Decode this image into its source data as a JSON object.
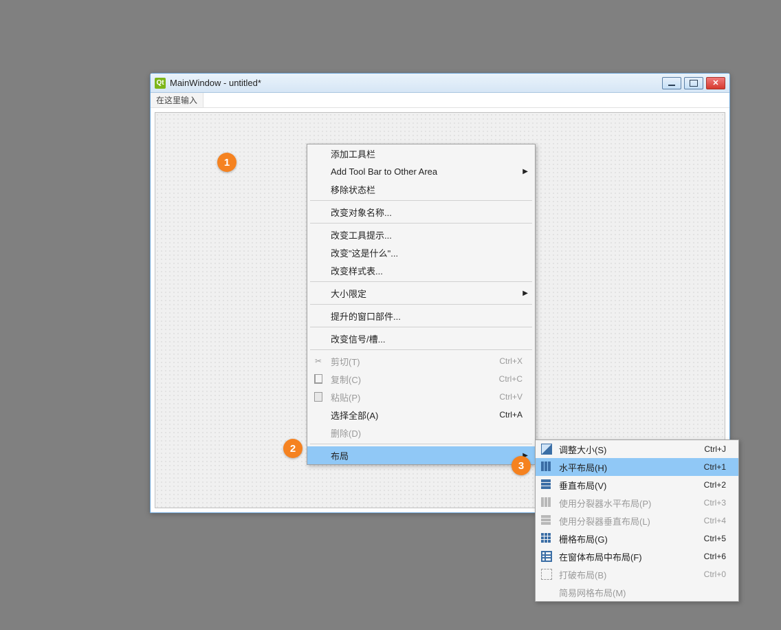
{
  "window": {
    "title": "MainWindow - untitled*"
  },
  "menubar": {
    "placeholder": "在这里输入"
  },
  "callouts": {
    "c1": "1",
    "c2": "2",
    "c3": "3"
  },
  "context_menu": {
    "items": [
      {
        "label": "添加工具栏",
        "submenu": false
      },
      {
        "label": "Add Tool Bar to Other Area",
        "submenu": true
      },
      {
        "label": "移除状态栏",
        "submenu": false
      }
    ],
    "group2": [
      {
        "label": "改变对象名称..."
      }
    ],
    "group3": [
      {
        "label": "改变工具提示..."
      },
      {
        "label": "改变\"这是什么\"..."
      },
      {
        "label": "改变样式表..."
      }
    ],
    "group4": [
      {
        "label": "大小限定",
        "submenu": true
      }
    ],
    "group5": [
      {
        "label": "提升的窗口部件..."
      }
    ],
    "group6": [
      {
        "label": "改变信号/槽..."
      }
    ],
    "edit_group": [
      {
        "label": "剪切(T)",
        "shortcut": "Ctrl+X",
        "icon": "scissors",
        "disabled": true
      },
      {
        "label": "复制(C)",
        "shortcut": "Ctrl+C",
        "icon": "copy",
        "disabled": true
      },
      {
        "label": "粘贴(P)",
        "shortcut": "Ctrl+V",
        "icon": "paste",
        "disabled": true
      },
      {
        "label": "选择全部(A)",
        "shortcut": "Ctrl+A",
        "disabled": false
      },
      {
        "label": "删除(D)",
        "disabled": true
      }
    ],
    "layout_item": {
      "label": "布局",
      "submenu": true
    }
  },
  "submenu": {
    "items": [
      {
        "label": "调整大小(S)",
        "shortcut": "Ctrl+J",
        "icon": "resize",
        "disabled": false
      },
      {
        "label": "水平布局(H)",
        "shortcut": "Ctrl+1",
        "icon": "hbox",
        "disabled": false,
        "highlight": true
      },
      {
        "label": "垂直布局(V)",
        "shortcut": "Ctrl+2",
        "icon": "vbox",
        "disabled": false
      },
      {
        "label": "使用分裂器水平布局(P)",
        "shortcut": "Ctrl+3",
        "icon": "hsplit",
        "disabled": true
      },
      {
        "label": "使用分裂器垂直布局(L)",
        "shortcut": "Ctrl+4",
        "icon": "vsplit",
        "disabled": true
      },
      {
        "label": "栅格布局(G)",
        "shortcut": "Ctrl+5",
        "icon": "grid",
        "disabled": false
      },
      {
        "label": "在窗体布局中布局(F)",
        "shortcut": "Ctrl+6",
        "icon": "form",
        "disabled": false
      },
      {
        "label": "打破布局(B)",
        "shortcut": "Ctrl+0",
        "icon": "break",
        "disabled": true
      },
      {
        "label": "简易网格布局(M)",
        "shortcut": "",
        "disabled": true
      }
    ]
  }
}
